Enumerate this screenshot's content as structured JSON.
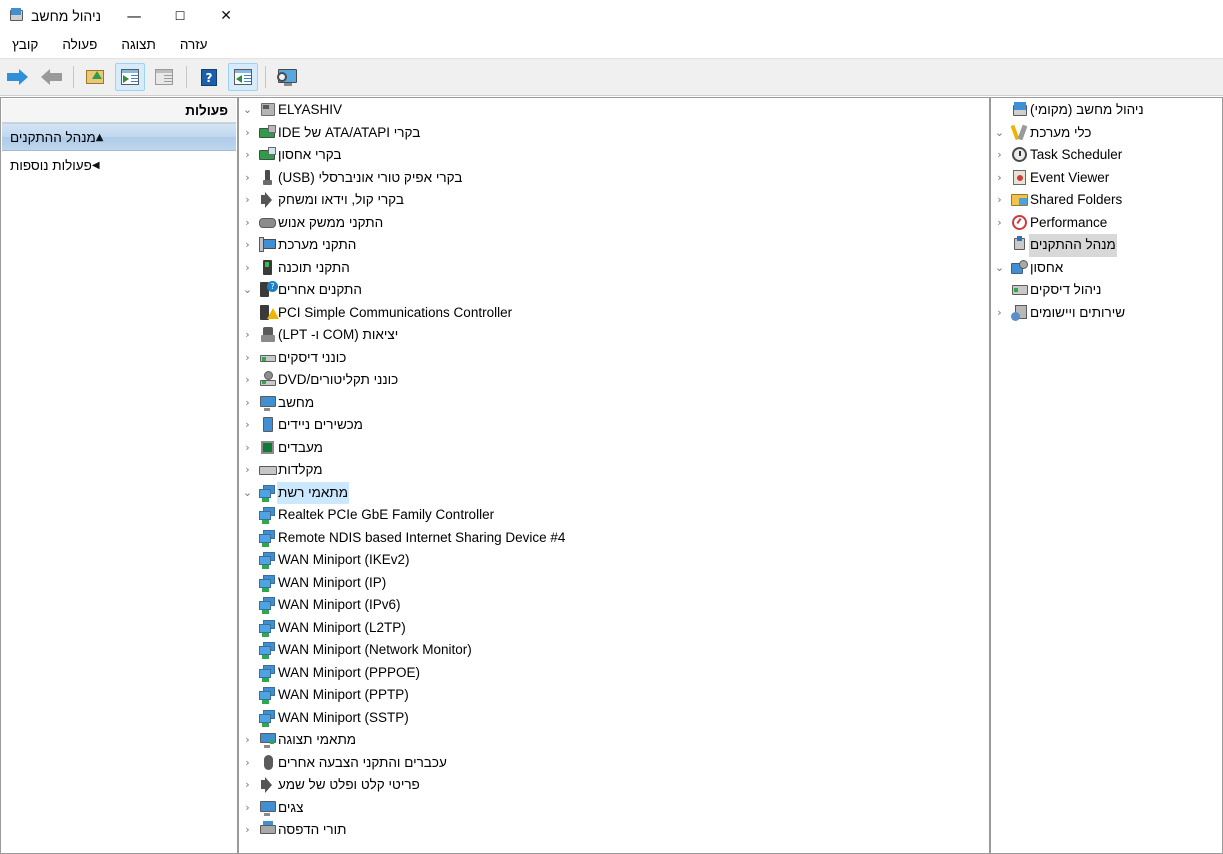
{
  "window": {
    "title": "ניהול מחשב",
    "title_icon": "computer-management-icon",
    "controls": {
      "minimize": "—",
      "maximize": "☐",
      "close": "✕"
    }
  },
  "menubar": {
    "items": [
      {
        "label": "קובץ",
        "name": "menu-file"
      },
      {
        "label": "פעולה",
        "name": "menu-action"
      },
      {
        "label": "תצוגה",
        "name": "menu-view"
      },
      {
        "label": "עזרה",
        "name": "menu-help"
      }
    ]
  },
  "toolbar": {
    "buttons": [
      {
        "name": "forward-button",
        "icon": "arrow-right-icon",
        "active": false
      },
      {
        "name": "back-button",
        "icon": "arrow-left-icon",
        "active": false
      },
      {
        "name": "export-list-button",
        "icon": "export-folder-icon",
        "active": false
      },
      {
        "name": "show-hide-console-tree-button",
        "icon": "console-tree-icon",
        "active": true
      },
      {
        "name": "properties-button",
        "icon": "properties-window-icon",
        "active": false
      },
      {
        "name": "help-button",
        "icon": "help-question-icon",
        "active": false
      },
      {
        "name": "show-hide-action-pane-button",
        "icon": "action-pane-icon",
        "active": true
      },
      {
        "name": "scan-hardware-changes-button",
        "icon": "monitor-scan-icon",
        "active": false
      }
    ]
  },
  "nav_tree": {
    "items": [
      {
        "label": "ניהול מחשב (מקומי)",
        "level": 0,
        "twist": "none",
        "icon": "computer-management-icon",
        "selected": false
      },
      {
        "label": "כלי מערכת",
        "level": 1,
        "twist": "expanded",
        "icon": "system-tools-icon",
        "selected": false
      },
      {
        "label": "Task Scheduler",
        "level": 2,
        "twist": "collapsed",
        "icon": "clock-icon",
        "selected": false,
        "ltr": true
      },
      {
        "label": "Event Viewer",
        "level": 2,
        "twist": "collapsed",
        "icon": "event-log-icon",
        "selected": false,
        "ltr": true
      },
      {
        "label": "Shared Folders",
        "level": 2,
        "twist": "collapsed",
        "icon": "shared-folders-icon",
        "selected": false,
        "ltr": true
      },
      {
        "label": "Performance",
        "level": 2,
        "twist": "collapsed",
        "icon": "performance-gauge-icon",
        "selected": false,
        "ltr": true
      },
      {
        "label": "מנהל ההתקנים",
        "level": 2,
        "twist": "none",
        "icon": "device-manager-icon",
        "selected": "grey"
      },
      {
        "label": "אחסון",
        "level": 1,
        "twist": "expanded",
        "icon": "storage-icon",
        "selected": false
      },
      {
        "label": "ניהול דיסקים",
        "level": 2,
        "twist": "none",
        "icon": "disk-management-icon",
        "selected": false
      },
      {
        "label": "שירותים ויישומים",
        "level": 1,
        "twist": "collapsed",
        "icon": "services-apps-icon",
        "selected": false
      }
    ]
  },
  "device_tree": {
    "items": [
      {
        "label": "ELYASHIV",
        "level": 0,
        "twist": "expanded",
        "icon": "computer-icon",
        "selected": false,
        "ltr": true
      },
      {
        "label": "בקרי ATA/ATAPI של IDE",
        "level": 1,
        "twist": "collapsed",
        "icon": "ide-controller-icon",
        "selected": false
      },
      {
        "label": "בקרי אחסון",
        "level": 1,
        "twist": "collapsed",
        "icon": "storage-controller-icon",
        "selected": false
      },
      {
        "label": "בקרי אפיק טורי אוניברסלי (USB)",
        "level": 1,
        "twist": "collapsed",
        "icon": "usb-controller-icon",
        "selected": false
      },
      {
        "label": "בקרי קול, וידאו ומשחק",
        "level": 1,
        "twist": "collapsed",
        "icon": "sound-icon",
        "selected": false
      },
      {
        "label": "התקני ממשק אנוש",
        "level": 1,
        "twist": "collapsed",
        "icon": "hid-gamepad-icon",
        "selected": false
      },
      {
        "label": "התקני מערכת",
        "level": 1,
        "twist": "collapsed",
        "icon": "system-device-icon",
        "selected": false
      },
      {
        "label": "התקני תוכנה",
        "level": 1,
        "twist": "collapsed",
        "icon": "software-device-icon",
        "selected": false
      },
      {
        "label": "התקנים אחרים",
        "level": 1,
        "twist": "expanded",
        "icon": "other-device-icon",
        "selected": false
      },
      {
        "label": "PCI Simple Communications Controller",
        "level": 2,
        "twist": "none",
        "icon": "unknown-device-warning-icon",
        "selected": false,
        "ltr": true
      },
      {
        "label": "יציאות (COM ו- LPT)",
        "level": 1,
        "twist": "collapsed",
        "icon": "ports-icon",
        "selected": false
      },
      {
        "label": "כונני דיסקים",
        "level": 1,
        "twist": "collapsed",
        "icon": "disk-drive-icon",
        "selected": false
      },
      {
        "label": "כונני תקליטורים/DVD",
        "level": 1,
        "twist": "collapsed",
        "icon": "dvd-drive-icon",
        "selected": false
      },
      {
        "label": "מחשב",
        "level": 1,
        "twist": "collapsed",
        "icon": "computer-node-icon",
        "selected": false
      },
      {
        "label": "מכשירים ניידים",
        "level": 1,
        "twist": "collapsed",
        "icon": "portable-device-icon",
        "selected": false
      },
      {
        "label": "מעבדים",
        "level": 1,
        "twist": "collapsed",
        "icon": "processor-icon",
        "selected": false
      },
      {
        "label": "מקלדות",
        "level": 1,
        "twist": "collapsed",
        "icon": "keyboard-icon",
        "selected": false
      },
      {
        "label": "מתאמי רשת",
        "level": 1,
        "twist": "expanded",
        "icon": "network-adapter-icon",
        "selected": "blue"
      },
      {
        "label": "Realtek PCIe GbE Family Controller",
        "level": 2,
        "twist": "none",
        "icon": "network-adapter-icon",
        "selected": false,
        "ltr": true
      },
      {
        "label": "Remote NDIS based Internet Sharing Device #4",
        "level": 2,
        "twist": "none",
        "icon": "network-adapter-icon",
        "selected": false,
        "ltr": true
      },
      {
        "label": "WAN Miniport (IKEv2)",
        "level": 2,
        "twist": "none",
        "icon": "network-adapter-icon",
        "selected": false,
        "ltr": true
      },
      {
        "label": "WAN Miniport (IP)",
        "level": 2,
        "twist": "none",
        "icon": "network-adapter-icon",
        "selected": false,
        "ltr": true
      },
      {
        "label": "WAN Miniport (IPv6)",
        "level": 2,
        "twist": "none",
        "icon": "network-adapter-icon",
        "selected": false,
        "ltr": true
      },
      {
        "label": "WAN Miniport (L2TP)",
        "level": 2,
        "twist": "none",
        "icon": "network-adapter-icon",
        "selected": false,
        "ltr": true
      },
      {
        "label": "WAN Miniport (Network Monitor)",
        "level": 2,
        "twist": "none",
        "icon": "network-adapter-icon",
        "selected": false,
        "ltr": true
      },
      {
        "label": "WAN Miniport (PPPOE)",
        "level": 2,
        "twist": "none",
        "icon": "network-adapter-icon",
        "selected": false,
        "ltr": true
      },
      {
        "label": "WAN Miniport (PPTP)",
        "level": 2,
        "twist": "none",
        "icon": "network-adapter-icon",
        "selected": false,
        "ltr": true
      },
      {
        "label": "WAN Miniport (SSTP)",
        "level": 2,
        "twist": "none",
        "icon": "network-adapter-icon",
        "selected": false,
        "ltr": true
      },
      {
        "label": "מתאמי תצוגה",
        "level": 1,
        "twist": "collapsed",
        "icon": "display-adapter-icon",
        "selected": false
      },
      {
        "label": "עכברים והתקני הצבעה אחרים",
        "level": 1,
        "twist": "collapsed",
        "icon": "mouse-icon",
        "selected": false
      },
      {
        "label": "פריטי קלט ופלט של שמע",
        "level": 1,
        "twist": "collapsed",
        "icon": "audio-io-icon",
        "selected": false
      },
      {
        "label": "צגים",
        "level": 1,
        "twist": "collapsed",
        "icon": "monitor-icon",
        "selected": false
      },
      {
        "label": "תורי הדפסה",
        "level": 1,
        "twist": "collapsed",
        "icon": "print-queue-icon",
        "selected": false
      }
    ]
  },
  "actions_pane": {
    "header": "פעולות",
    "rows": [
      {
        "label": "מנהל ההתקנים",
        "selected": true,
        "arrow": "▲",
        "name": "actions-item-device-manager"
      },
      {
        "label": "פעולות נוספות",
        "selected": false,
        "arrow": "◀",
        "name": "actions-item-more-actions"
      }
    ]
  },
  "colors": {
    "selection_blue": "#cce8ff",
    "selection_grey": "#d8d8d8",
    "toolbar_bg": "#f0f0f0",
    "toolbar_active": "#d6ebfb",
    "pane_border": "#9a9a9a",
    "accent": "#3f8fd2"
  }
}
